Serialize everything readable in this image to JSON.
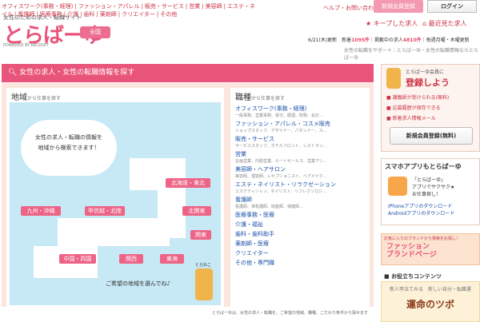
{
  "topnav": [
    "オフィスワーク(事務・経理)",
    "ファッション・アパレル",
    "販売・サービス",
    "営業",
    "美容師",
    "エステ・ネイル",
    "看護師",
    "医療事務",
    "介護",
    "歯科",
    "薬剤師",
    "クリエイター",
    "その他"
  ],
  "tagline": "女性のための求人・転職サイト",
  "logo": "とらばーゆ",
  "powered": "POWERED BY RECRUIT",
  "area_btn": "全国",
  "help": "ヘルプ・お問い合わせ",
  "register": "新規会員登録",
  "login": "ログイン",
  "kept": "キープした求人",
  "recent": "最近見た求人",
  "stats": {
    "date": "6/21(木)更新",
    "newlabel": "新着",
    "new": "1095件",
    "postedlabel": "掲載中の求人",
    "posted": "4810件",
    "weekly": "毎週月曜・木曜更新"
  },
  "about": "女性の転職をサポート｜とらばーゆ・女性の転職情報ならとらばーゆ",
  "mainbar": "女性の求人・女性の転職情報を探す",
  "region": {
    "title": "地域",
    "sub": "から仕事を探す",
    "speech1": "女性の求人・転職の情報を",
    "speech2": "地域から検索できます！",
    "hint": "ご希望の地域を選んでね♪",
    "catlabel": "とらねこ",
    "areas": [
      "北海道・東北",
      "九州・沖縄",
      "甲信越・北陸",
      "北関東",
      "関東",
      "中国・四国",
      "関西",
      "東海"
    ]
  },
  "jobs": {
    "title": "職種",
    "sub": "から仕事を探す",
    "items": [
      {
        "l": "オフィスワーク(事務・経理)",
        "s": "一般事務、営業事務、受付、経理、財務、会計..."
      },
      {
        "l": "ファッション・アパレル・コスメ販売",
        "s": "ショップスタッフ、デザイナー、パタンナー、ス..."
      },
      {
        "l": "販売・サービス",
        "s": "サービススタッフ、ホテルフロント、レストラン..."
      },
      {
        "l": "営業",
        "s": "企画営業、内勤営業、ルートセールス、営業アシ..."
      },
      {
        "l": "美容師・ヘアサロン",
        "s": "美容師、理容師、レセプショニスト、ヘアメイク..."
      },
      {
        "l": "エステ・ネイリスト・リラクゼーション",
        "s": "エステティシャン、ネイリスト、リフレクソロジ..."
      },
      {
        "l": "看護師",
        "s": "看護師、准看護師、助産師、保健師..."
      },
      {
        "l": "医療事務・医療",
        "s": ""
      },
      {
        "l": "介護・福祉",
        "s": ""
      },
      {
        "l": "歯科・歯科助手",
        "s": ""
      },
      {
        "l": "薬剤師・医療",
        "s": ""
      },
      {
        "l": "クリエイター",
        "s": ""
      },
      {
        "l": "その他・専門職",
        "s": ""
      }
    ]
  },
  "member": {
    "t1": "とらばーゆ会員に",
    "t2": "登録しよう",
    "items": [
      "講義師が受けられる(無料)",
      "応募履歴が保存できる",
      "新着求人情報メール"
    ],
    "btn": "新規会員登録(無料)"
  },
  "app": {
    "title": "スマホアプリもとらばーゆ",
    "d1": "「とらばーゆ」",
    "d2": "アプリでサクサク★",
    "d3": "お仕事探し！",
    "l1": "iPhoneアプリのダウンロード",
    "l2": "Androidアプリのダウンロード"
  },
  "banner": {
    "s": "お気に入りのブランドから検索をお探し！",
    "b1": "ファッション",
    "b2": "ブランドページ"
  },
  "useful": "お役立ちコンテンツ",
  "fortune": {
    "a": "新人甲法てみる　新しい自分・転職運",
    "b": "運命のツボ"
  },
  "footer": "とらばーゆは、女性の求人・転職を、ご希望の地域、職種、こだわり条件から探せます"
}
